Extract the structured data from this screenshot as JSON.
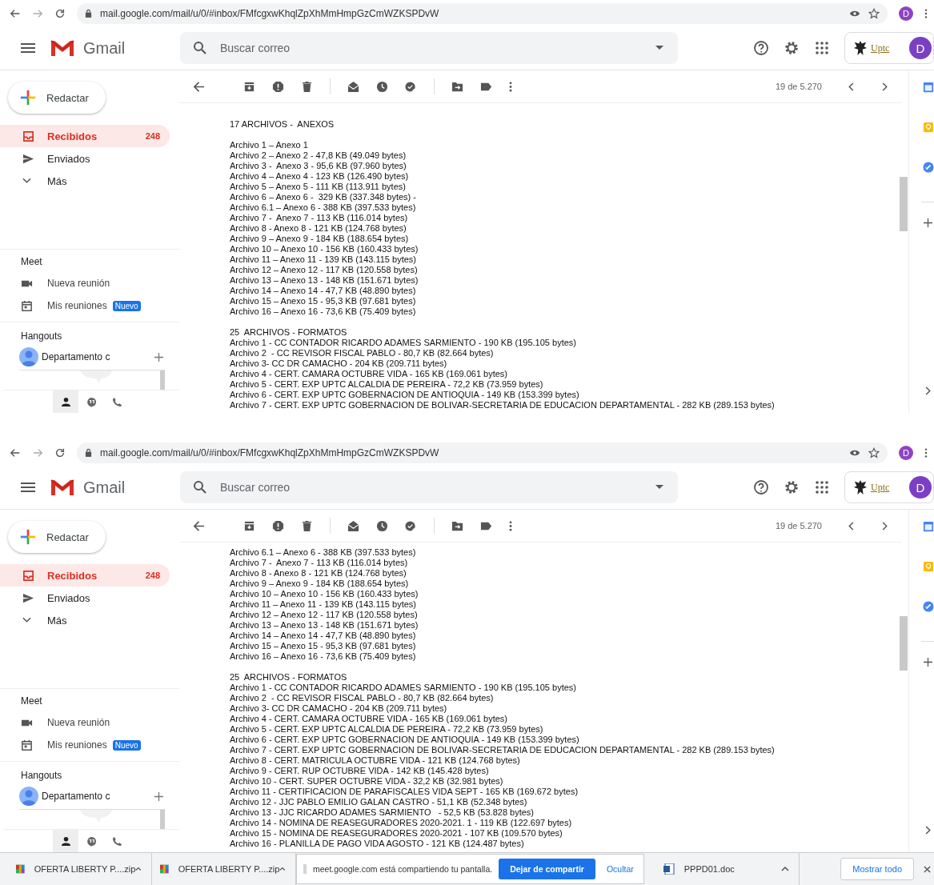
{
  "screens": [
    {
      "url": "mail.google.com/mail/u/0/#inbox/FMfcgxwKhqlZpXhMmHmpGzCmWZKSPDvW",
      "profile_initial": "D",
      "app_name": "Gmail",
      "search": {
        "placeholder": "Buscar correo"
      },
      "account_initial": "D",
      "org_logo_text": "Uptc",
      "compose": "Redactar",
      "folders": [
        {
          "kind": "inbox",
          "label": "Recibidos",
          "count": "248",
          "selected": true
        },
        {
          "kind": "sent",
          "label": "Enviados",
          "selected": false
        },
        {
          "kind": "more",
          "label": "Más",
          "selected": false
        }
      ],
      "meet": {
        "title": "Meet",
        "items": [
          {
            "kind": "video",
            "label": "Nueva reunión"
          },
          {
            "kind": "calendar",
            "label": "Mis reuniones",
            "badge": "Nuevo"
          }
        ]
      },
      "hangouts": {
        "title": "Hangouts",
        "contact": "Departamento c",
        "tabs": [
          {
            "kind": "person",
            "selected": true
          },
          {
            "kind": "chat",
            "selected": false
          },
          {
            "kind": "phone",
            "selected": false
          }
        ]
      },
      "pager": "19 de 5.270",
      "message": [
        {
          "lines": [
            "17 ARCHIVOS -  ANEXOS"
          ]
        },
        {
          "lines": [
            "Archivo 1 – Anexo 1",
            "Archivo 2 – Anexo 2 - 47,8 KB (49.049 bytes)",
            "Archivo 3 -  Anexo 3 - 95,6 KB (97.960 bytes)",
            "Archivo 4 – Anexo 4 - 123 KB (126.490 bytes)",
            "Archivo 5 – Anexo 5 - 111 KB (113.911 bytes)",
            "Archivo 6 – Anexo 6 -  329 KB (337.348 bytes) -",
            "Archivo 6.1 – Anexo 6 - 388 KB (397.533 bytes)",
            "Archivo 7 -  Anexo 7 - 113 KB (116.014 bytes)",
            "Archivo 8 - Anexo 8 - 121 KB (124.768 bytes)",
            "Archivo 9 – Anexo 9 - 184 KB (188.654 bytes)",
            "Archivo 10 – Anexo 10 - 156 KB (160.433 bytes)",
            "Archivo 11 – Anexo 11 - 139 KB (143.115 bytes)",
            "Archivo 12 – Anexo 12 - 117 KB (120.558 bytes)",
            "Archivo 13 – Anexo 13 - 148 KB (151.671 bytes)",
            "Archivo 14 – Anexo 14 - 47,7 KB (48.890 bytes)",
            "Archivo 15 – Anexo 15 - 95,3 KB (97.681 bytes)",
            "Archivo 16 – Anexo 16 - 73,6 KB (75.409 bytes)"
          ]
        },
        {
          "lines": [
            "25  ARCHIVOS - FORMATOS",
            "Archivo 1 - CC CONTADOR RICARDO ADAMES SARMIENTO - 190 KB (195.105 bytes)",
            "Archivo 2  - CC REVISOR FISCAL PABLO - 80,7 KB (82.664 bytes)",
            "Archivo 3- CC DR CAMACHO - 204 KB (209.711 bytes)",
            "Archivo 4 - CERT. CAMARA OCTUBRE VIDA - 165 KB (169.061 bytes)",
            "Archivo 5 - CERT. EXP UPTC ALCALDIA DE PEREIRA - 72,2 KB (73.959 bytes)",
            "Archivo 6 - CERT. EXP UPTC GOBERNACION DE ANTIOQUIA - 149 KB (153.399 bytes)",
            "Archivo 7 - CERT. EXP UPTC GOBERNACION DE BOLIVAR-SECRETARIA DE EDUCACION DEPARTAMENTAL - 282 KB (289.153 bytes)"
          ]
        }
      ]
    },
    {
      "url": "mail.google.com/mail/u/0/#inbox/FMfcgxwKhqlZpXhMmHmpGzCmWZKSPDvW",
      "profile_initial": "D",
      "app_name": "Gmail",
      "search": {
        "placeholder": "Buscar correo"
      },
      "account_initial": "D",
      "org_logo_text": "Uptc",
      "compose": "Redactar",
      "folders": [
        {
          "kind": "inbox",
          "label": "Recibidos",
          "count": "248",
          "selected": true
        },
        {
          "kind": "sent",
          "label": "Enviados",
          "selected": false
        },
        {
          "kind": "more",
          "label": "Más",
          "selected": false
        }
      ],
      "meet": {
        "title": "Meet",
        "items": [
          {
            "kind": "video",
            "label": "Nueva reunión"
          },
          {
            "kind": "calendar",
            "label": "Mis reuniones",
            "badge": "Nuevo"
          }
        ]
      },
      "hangouts": {
        "title": "Hangouts",
        "contact": "Departamento c",
        "tabs": [
          {
            "kind": "person",
            "selected": true
          },
          {
            "kind": "chat",
            "selected": false
          },
          {
            "kind": "phone",
            "selected": false
          }
        ]
      },
      "pager": "19 de 5.270",
      "message": [
        {
          "lines": [
            "Archivo 6.1 – Anexo 6 - 388 KB (397.533 bytes)",
            "Archivo 7 -  Anexo 7 - 113 KB (116.014 bytes)",
            "Archivo 8 - Anexo 8 - 121 KB (124.768 bytes)",
            "Archivo 9 – Anexo 9 - 184 KB (188.654 bytes)",
            "Archivo 10 – Anexo 10 - 156 KB (160.433 bytes)",
            "Archivo 11 – Anexo 11 - 139 KB (143.115 bytes)",
            "Archivo 12 – Anexo 12 - 117 KB (120.558 bytes)",
            "Archivo 13 – Anexo 13 - 148 KB (151.671 bytes)",
            "Archivo 14 – Anexo 14 - 47,7 KB (48.890 bytes)",
            "Archivo 15 – Anexo 15 - 95,3 KB (97.681 bytes)",
            "Archivo 16 – Anexo 16 - 73,6 KB (75.409 bytes)"
          ]
        },
        {
          "lines": [
            "25  ARCHIVOS - FORMATOS",
            "Archivo 1 - CC CONTADOR RICARDO ADAMES SARMIENTO - 190 KB (195.105 bytes)",
            "Archivo 2  - CC REVISOR FISCAL PABLO - 80,7 KB (82.664 bytes)",
            "Archivo 3- CC DR CAMACHO - 204 KB (209.711 bytes)",
            "Archivo 4 - CERT. CAMARA OCTUBRE VIDA - 165 KB (169.061 bytes)",
            "Archivo 5 - CERT. EXP UPTC ALCALDIA DE PEREIRA - 72,2 KB (73.959 bytes)",
            "Archivo 6 - CERT. EXP UPTC GOBERNACION DE ANTIOQUIA - 149 KB (153.399 bytes)",
            "Archivo 7 - CERT. EXP UPTC GOBERNACION DE BOLIVAR-SECRETARIA DE EDUCACION DEPARTAMENTAL - 282 KB (289.153 bytes)",
            "Archivo 8 - CERT. MATRICULA OCTUBRE VIDA - 121 KB (124.768 bytes)",
            "Archivo 9 - CERT. RUP OCTUBRE VIDA - 142 KB (145.428 bytes)",
            "Archivo 10 - CERT. SUPER OCTUBRE VIDA - 32,2 KB (32.981 bytes)",
            "Archivo 11 - CERTIFICACION DE PARAFISCALES VIDA SEPT - 165 KB (169.672 bytes)",
            "Archivo 12 - JJC PABLO EMILIO GALAN CASTRO - 51,1 KB (52.348 bytes)",
            "Archivo 13 - JJC RICARDO ADAMES SARMIENTO   - 52,5 KB (53.828 bytes)",
            "Archivo 14 - NOMINA DE REASEGURADORES 2020-2021. 1 - 119 KB (122.697 bytes)",
            "Archivo 15 - NOMINA DE REASEGURADORES 2020-2021 - 107 KB (109.570 bytes)",
            "Archivo 16 - PLANILLA DE PAGO VIDA AGOSTO - 121 KB (124.487 bytes)"
          ]
        }
      ]
    }
  ],
  "downloads": {
    "items": [
      {
        "kind": "archive",
        "name": "OFERTA LIBERTY P....zip"
      },
      {
        "kind": "archive",
        "name": "OFERTA LIBERTY P....zip"
      },
      {
        "kind": "share",
        "message": "meet.google.com está compartiendo tu pantalla.",
        "stop": "Dejar de compartir",
        "hide": "Ocultar"
      },
      {
        "kind": "document",
        "name": "PPPD01.doc"
      }
    ],
    "show_all": "Mostrar todo"
  }
}
